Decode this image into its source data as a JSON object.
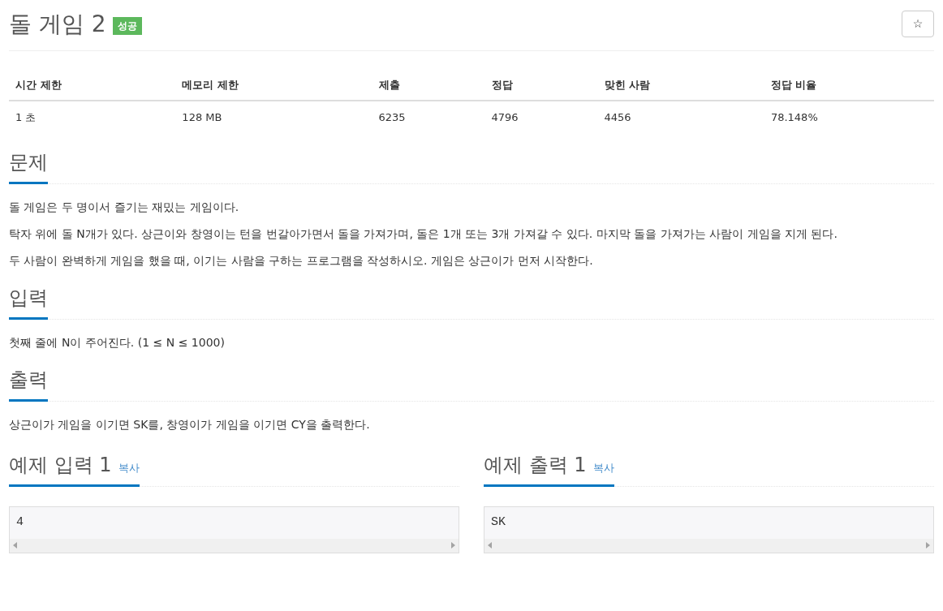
{
  "title": "돌 게임 2",
  "result_badge": "성공",
  "star_button": "☆",
  "info_table": {
    "columns": [
      "시간 제한",
      "메모리 제한",
      "제출",
      "정답",
      "맞힌 사람",
      "정답 비율"
    ],
    "rows": [
      [
        "1 초",
        "128 MB",
        "6235",
        "4796",
        "4456",
        "78.148%"
      ]
    ]
  },
  "sections": [
    {
      "heading": "문제",
      "paragraphs": [
        "돌 게임은 두 명이서 즐기는 재밌는 게임이다.",
        "탁자 위에 돌 N개가 있다. 상근이와 창영이는 턴을 번갈아가면서 돌을 가져가며, 돌은 1개 또는 3개 가져갈 수 있다. 마지막 돌을 가져가는 사람이 게임을 지게 된다.",
        "두 사람이 완벽하게 게임을 했을 때, 이기는 사람을 구하는 프로그램을 작성하시오. 게임은 상근이가 먼저 시작한다."
      ]
    },
    {
      "heading": "입력",
      "paragraphs": [
        "첫째 줄에 N이 주어진다. (1 ≤ N ≤ 1000)"
      ]
    },
    {
      "heading": "출력",
      "paragraphs": [
        "상근이가 게임을 이기면 SK를, 창영이가 게임을 이기면 CY을 출력한다."
      ]
    }
  ],
  "samples": [
    {
      "heading": "예제 입력 1",
      "copy": "복사",
      "content": "4"
    },
    {
      "heading": "예제 출력 1",
      "copy": "복사",
      "content": "SK"
    }
  ]
}
